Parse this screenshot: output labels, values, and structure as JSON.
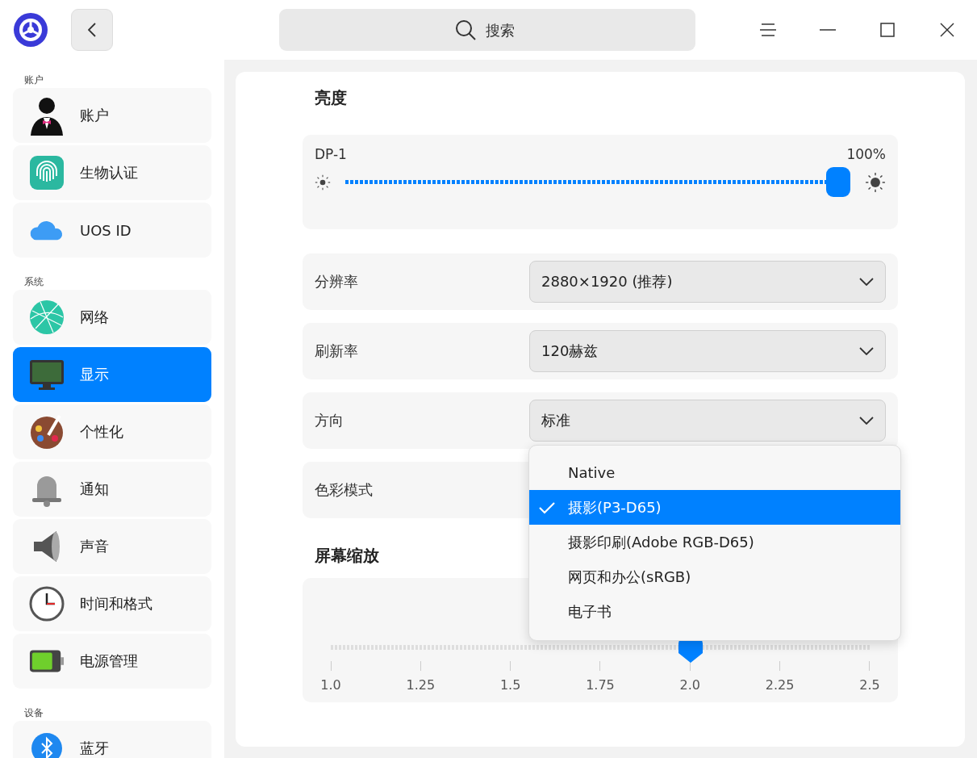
{
  "header": {
    "search": {
      "placeholder": "搜索"
    }
  },
  "sidebar": {
    "sections": [
      {
        "title": "账户",
        "items": [
          {
            "label": "账户",
            "selected": false
          },
          {
            "label": "生物认证",
            "selected": false
          },
          {
            "label": "UOS ID",
            "selected": false
          }
        ]
      },
      {
        "title": "系统",
        "items": [
          {
            "label": "网络",
            "selected": false
          },
          {
            "label": "显示",
            "selected": true
          },
          {
            "label": "个性化",
            "selected": false
          },
          {
            "label": "通知",
            "selected": false
          },
          {
            "label": "声音",
            "selected": false
          },
          {
            "label": "时间和格式",
            "selected": false
          },
          {
            "label": "电源管理",
            "selected": false
          }
        ]
      },
      {
        "title": "设备",
        "items": [
          {
            "label": "蓝牙",
            "selected": false
          }
        ]
      }
    ]
  },
  "brightness": {
    "title": "亮度",
    "monitor": "DP-1",
    "reading": "100%",
    "level": 1.0
  },
  "settings": [
    {
      "label": "分辨率",
      "value": "2880×1920 (推荐)"
    },
    {
      "label": "刷新率",
      "value": "120赫兹"
    },
    {
      "label": "方向",
      "value": "标准"
    },
    {
      "label": "色彩模式"
    }
  ],
  "color_menu": [
    {
      "label": "Native",
      "selected": false
    },
    {
      "label": "摄影(P3-D65)",
      "selected": true
    },
    {
      "label": "摄影印刷(Adobe RGB-D65)",
      "selected": false
    },
    {
      "label": "网页和办公(sRGB)",
      "selected": false
    },
    {
      "label": "电子书",
      "selected": false
    }
  ],
  "scale": {
    "title": "屏幕缩放",
    "level": 0.667,
    "ticks": [
      "1.0",
      "1.25",
      "1.5",
      "1.75",
      "2.0",
      "2.25",
      "2.5"
    ]
  }
}
